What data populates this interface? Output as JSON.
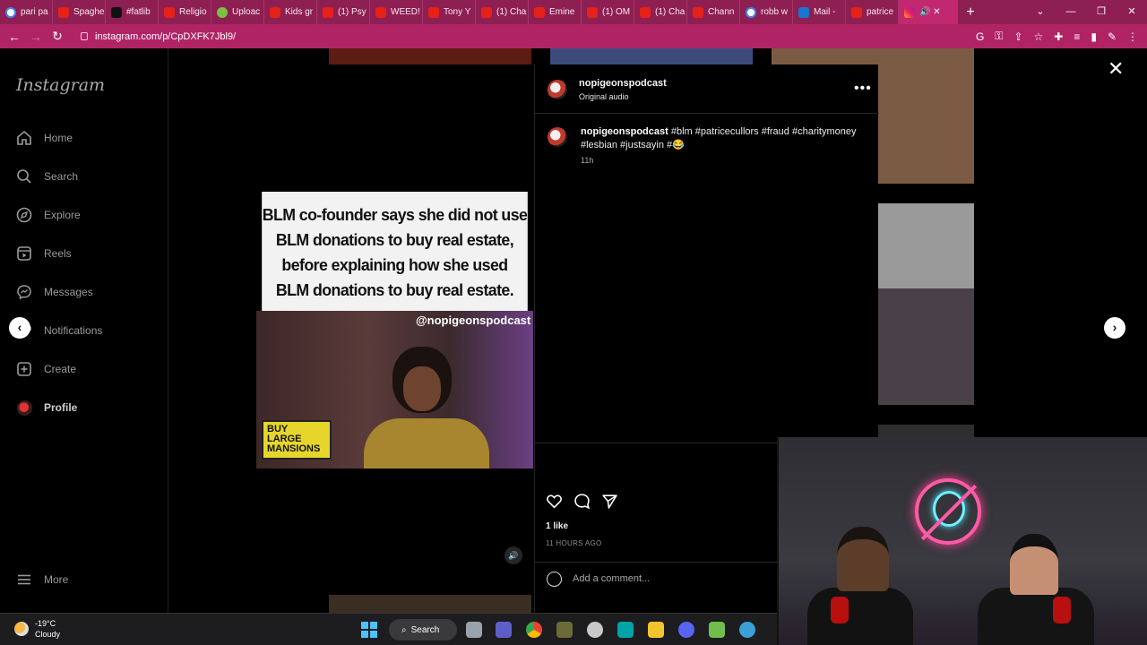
{
  "browser": {
    "tabs": [
      {
        "label": "pari pa",
        "icon": "g"
      },
      {
        "label": "Spaghe",
        "icon": "yt"
      },
      {
        "label": "#fatlib",
        "icon": "tk"
      },
      {
        "label": "Religio",
        "icon": "yt"
      },
      {
        "label": "Uploac",
        "icon": "rb"
      },
      {
        "label": "Kids gr",
        "icon": "yt"
      },
      {
        "label": "(1) Psy",
        "icon": "yt"
      },
      {
        "label": "WEED!",
        "icon": "yt"
      },
      {
        "label": "Tony Y",
        "icon": "yt"
      },
      {
        "label": "(1) Cha",
        "icon": "yt"
      },
      {
        "label": "Emine",
        "icon": "yt"
      },
      {
        "label": "(1) OM",
        "icon": "yt"
      },
      {
        "label": "(1) Cha",
        "icon": "yt"
      },
      {
        "label": "Chann",
        "icon": "yt"
      },
      {
        "label": "robb w",
        "icon": "g"
      },
      {
        "label": "Mail - ",
        "icon": "ms"
      },
      {
        "label": "patrice",
        "icon": "yt"
      }
    ],
    "active_tab_icon": "ig",
    "new_tab": "+",
    "url": "instagram.com/p/CpDXFK7Jbl9/"
  },
  "sidebar": {
    "logo": "Instagram",
    "items": [
      {
        "label": "Home",
        "icon": "home-icon"
      },
      {
        "label": "Search",
        "icon": "search-icon"
      },
      {
        "label": "Explore",
        "icon": "compass-icon"
      },
      {
        "label": "Reels",
        "icon": "reels-icon"
      },
      {
        "label": "Messages",
        "icon": "messenger-icon"
      },
      {
        "label": "Notifications",
        "icon": "heart-icon"
      },
      {
        "label": "Create",
        "icon": "plus-square-icon"
      },
      {
        "label": "Profile",
        "icon": "avatar"
      }
    ],
    "more": "More"
  },
  "post": {
    "media_text_lines": [
      "BLM co-founder says she did not use",
      "BLM donations to buy real estate,",
      "before explaining how she used",
      "BLM donations to buy real estate."
    ],
    "watermark": "@nopigeonspodcast",
    "sign_lines": [
      "BUY",
      "LARGE",
      "MANSIONS"
    ],
    "author": "nopigeonspodcast",
    "audio": "Original audio",
    "caption_tags": "#blm #patricecullors #fraud #charitymoney #lesbian #justsayin #😂",
    "caption_time": "11h",
    "likes": "1 like",
    "posted_ago": "11 HOURS AGO",
    "comment_placeholder": "Add a comment..."
  },
  "taskbar": {
    "temperature": "-19°C",
    "condition": "Cloudy",
    "search_label": "Search"
  }
}
